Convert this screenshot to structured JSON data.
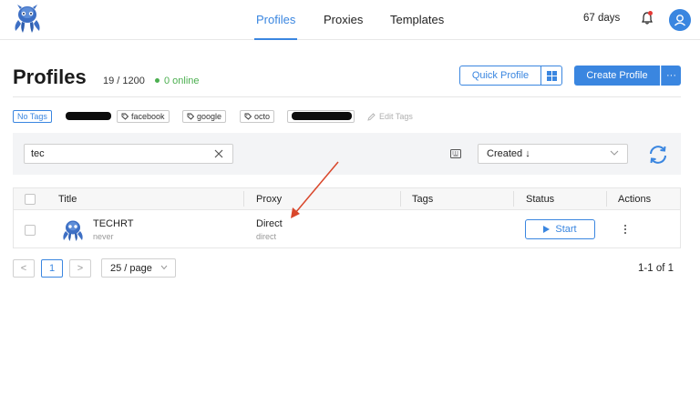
{
  "nav": {
    "tabs": [
      {
        "label": "Profiles",
        "active": true
      },
      {
        "label": "Proxies",
        "active": false
      },
      {
        "label": "Templates",
        "active": false
      }
    ],
    "days_left": "67 days",
    "accent_color": "#3a86e0"
  },
  "header": {
    "title": "Profiles",
    "count": "19 / 1200",
    "online": "0 online",
    "quick_profile_label": "Quick Profile",
    "create_profile_label": "Create Profile",
    "more_label": "···"
  },
  "tags": {
    "no_tags": "No Tags",
    "items": [
      "facebook",
      "google",
      "octo"
    ],
    "edit_label": "Edit Tags"
  },
  "filter": {
    "search_value": "tec",
    "sort_value": "Created ↓"
  },
  "table": {
    "columns": [
      "Title",
      "Proxy",
      "Tags",
      "Status",
      "Actions"
    ],
    "rows": [
      {
        "title": "TECHRT",
        "subtitle": "never",
        "proxy": "Direct",
        "proxy_type": "direct",
        "status_button": "Start"
      }
    ]
  },
  "pagination": {
    "prev": "<",
    "current": "1",
    "next": ">",
    "page_size": "25 / page",
    "range": "1-1 of 1"
  }
}
